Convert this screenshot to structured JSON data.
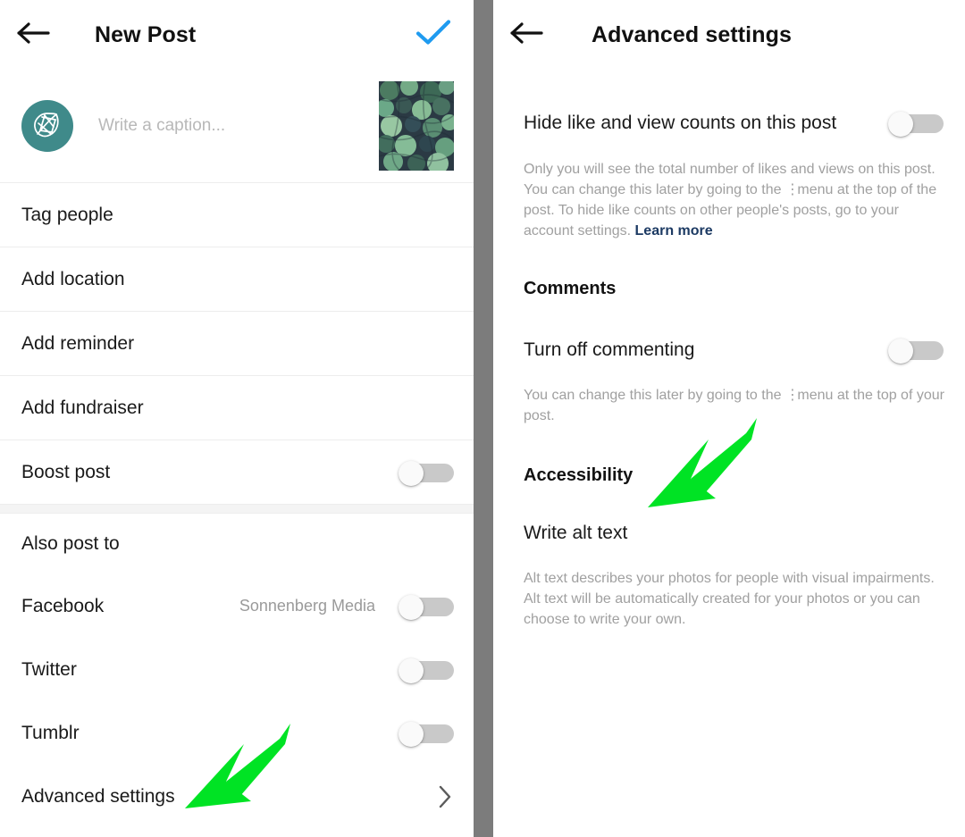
{
  "left": {
    "header": {
      "back_icon": "arrow-left-icon",
      "title": "New Post",
      "confirm_icon": "check-icon",
      "confirm_color": "#1f9bf0"
    },
    "composer": {
      "avatar_icon": "leaf-logo-avatar",
      "avatar_color": "#3f8a8a",
      "caption_placeholder": "Write a caption...",
      "thumbnail_alt": "succulent-plants-photo"
    },
    "options": [
      {
        "label": "Tag people",
        "type": "link"
      },
      {
        "label": "Add location",
        "type": "link"
      },
      {
        "label": "Add reminder",
        "type": "link"
      },
      {
        "label": "Add fundraiser",
        "type": "link"
      },
      {
        "label": "Boost post",
        "type": "toggle",
        "value": "off"
      }
    ],
    "also_post_to": {
      "heading": "Also post to",
      "items": [
        {
          "label": "Facebook",
          "account": "Sonnenberg Media",
          "value": "off"
        },
        {
          "label": "Twitter",
          "account": "",
          "value": "off"
        },
        {
          "label": "Tumblr",
          "account": "",
          "value": "off"
        }
      ]
    },
    "advanced_row": {
      "label": "Advanced settings",
      "chevron_icon": "chevron-right-icon"
    }
  },
  "right": {
    "header": {
      "back_icon": "arrow-left-icon",
      "title": "Advanced settings"
    },
    "hide_counts": {
      "label": "Hide like and view counts on this post",
      "value": "off",
      "help_part1": "Only you will see the total number of likes and views on this post. You can change this later by going to the",
      "help_dots": "⋮",
      "help_part2": "menu at the top of the post. To hide like counts on other people's posts, go to your account settings.",
      "link_label": "Learn more"
    },
    "comments": {
      "heading": "Comments",
      "label": "Turn off commenting",
      "value": "off",
      "help_part1": "You can change this later by going to the",
      "help_dots": "⋮",
      "help_part2": "menu at the top of your post."
    },
    "accessibility": {
      "heading": "Accessibility",
      "label": "Write alt text",
      "help": "Alt text describes your photos for people with visual impairments. Alt text will be automatically created for your photos or you can choose to write your own."
    }
  },
  "annotations": {
    "arrow_color": "#00e324",
    "arrow_left_target": "Advanced settings",
    "arrow_right_target": "Write alt text"
  }
}
